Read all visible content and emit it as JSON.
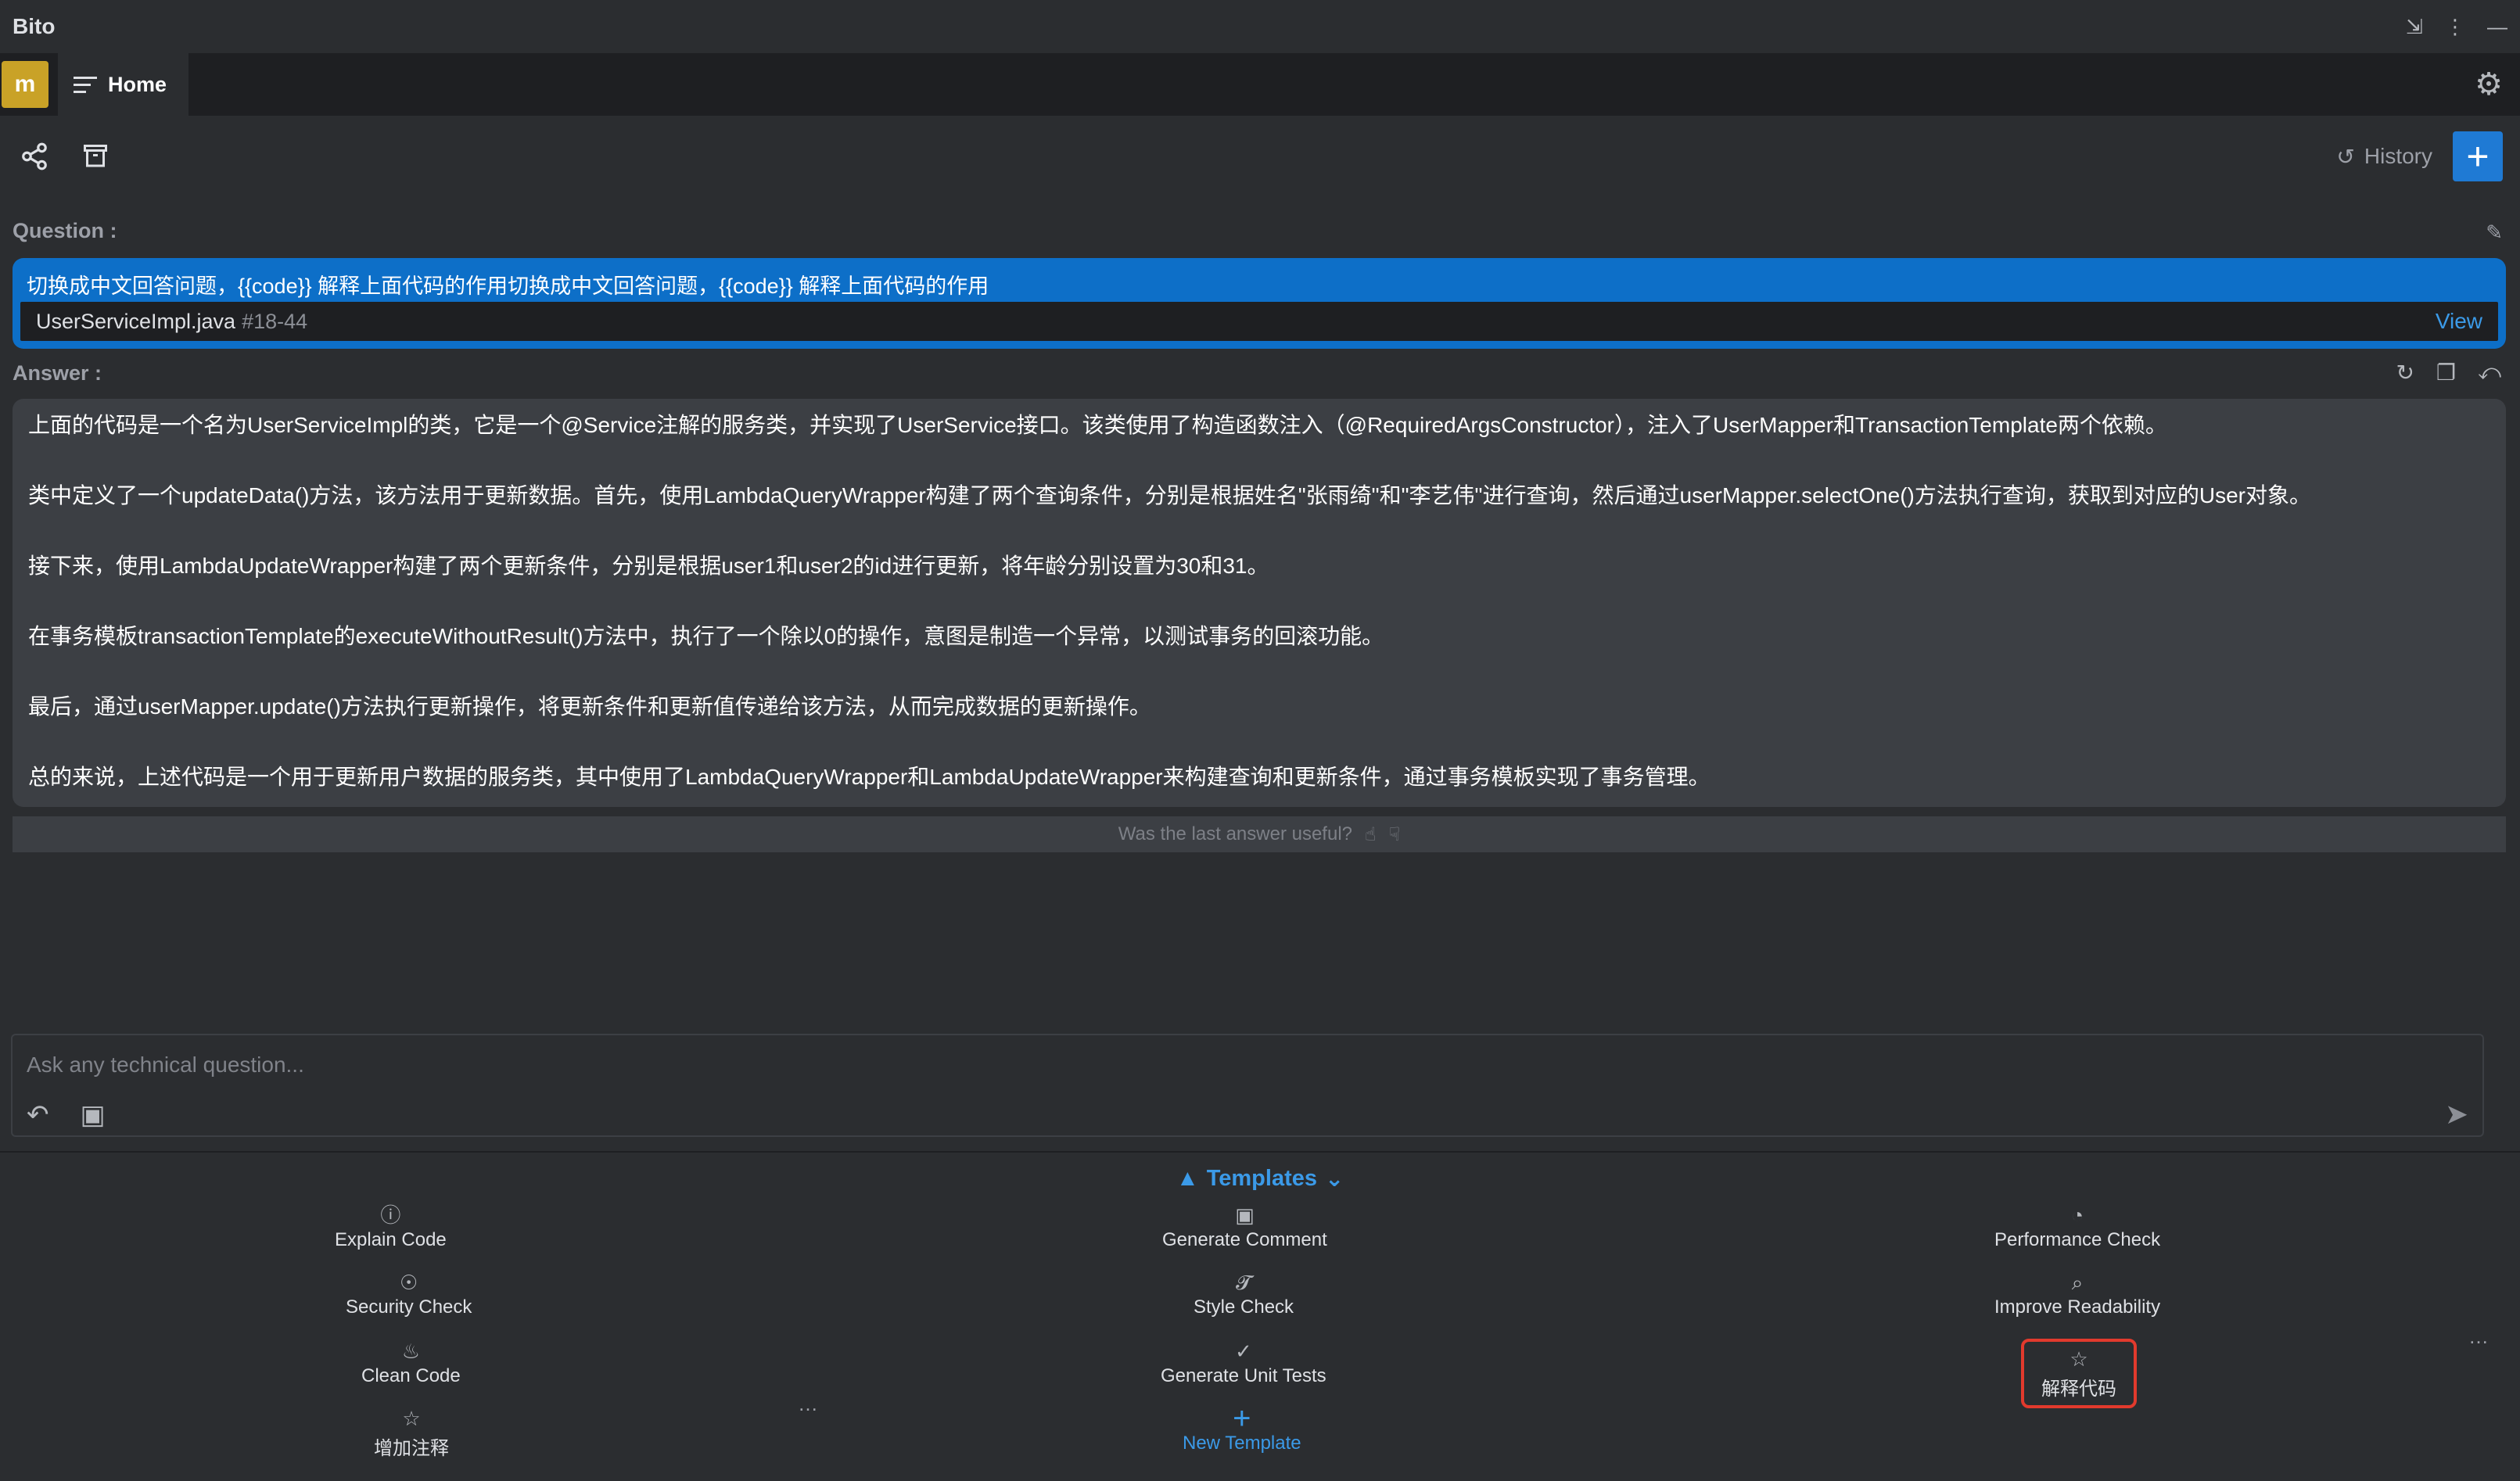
{
  "app": {
    "title": "Bito"
  },
  "tabs": {
    "avatar_letter": "m",
    "home_label": "Home"
  },
  "toolbar": {
    "history_label": "History"
  },
  "question": {
    "label": "Question :",
    "text": "切换成中文回答问题，{{code}} 解释上面代码的作用切换成中文回答问题，{{code}} 解释上面代码的作用",
    "file": "UserServiceImpl.java",
    "lines": "#18-44",
    "view_label": "View"
  },
  "answer": {
    "label": "Answer :",
    "paragraphs": [
      "上面的代码是一个名为UserServiceImpl的类，它是一个@Service注解的服务类，并实现了UserService接口。该类使用了构造函数注入（@RequiredArgsConstructor），注入了UserMapper和TransactionTemplate两个依赖。",
      "类中定义了一个updateData()方法，该方法用于更新数据。首先，使用LambdaQueryWrapper构建了两个查询条件，分别是根据姓名\"张雨绮\"和\"李艺伟\"进行查询，然后通过userMapper.selectOne()方法执行查询，获取到对应的User对象。",
      "接下来，使用LambdaUpdateWrapper构建了两个更新条件，分别是根据user1和user2的id进行更新，将年龄分别设置为30和31。",
      "在事务模板transactionTemplate的executeWithoutResult()方法中，执行了一个除以0的操作，意图是制造一个异常，以测试事务的回滚功能。",
      "最后，通过userMapper.update()方法执行更新操作，将更新条件和更新值传递给该方法，从而完成数据的更新操作。",
      "总的来说，上述代码是一个用于更新用户数据的服务类，其中使用了LambdaQueryWrapper和LambdaUpdateWrapper来构建查询和更新条件，通过事务模板实现了事务管理。"
    ],
    "feedback": "Was the last answer useful?"
  },
  "input": {
    "placeholder": "Ask any technical question..."
  },
  "templates": {
    "header": "Templates",
    "items": {
      "explain_code": "Explain Code",
      "generate_comment": "Generate Comment",
      "performance_check": "Performance Check",
      "security_check": "Security Check",
      "style_check": "Style Check",
      "improve_readability": "Improve Readability",
      "clean_code": "Clean Code",
      "generate_unit_tests": "Generate Unit Tests",
      "custom_explain": "解释代码",
      "custom_comment": "增加注释",
      "new_template": "New Template"
    }
  },
  "icons": {
    "share": "share-icon",
    "delete": "trash-icon",
    "history": "history-icon",
    "add": "plus-icon",
    "edit": "pencil-icon",
    "settings": "gear-icon",
    "accent": "#1f7ad4",
    "highlight_border": "#e23a2d"
  }
}
